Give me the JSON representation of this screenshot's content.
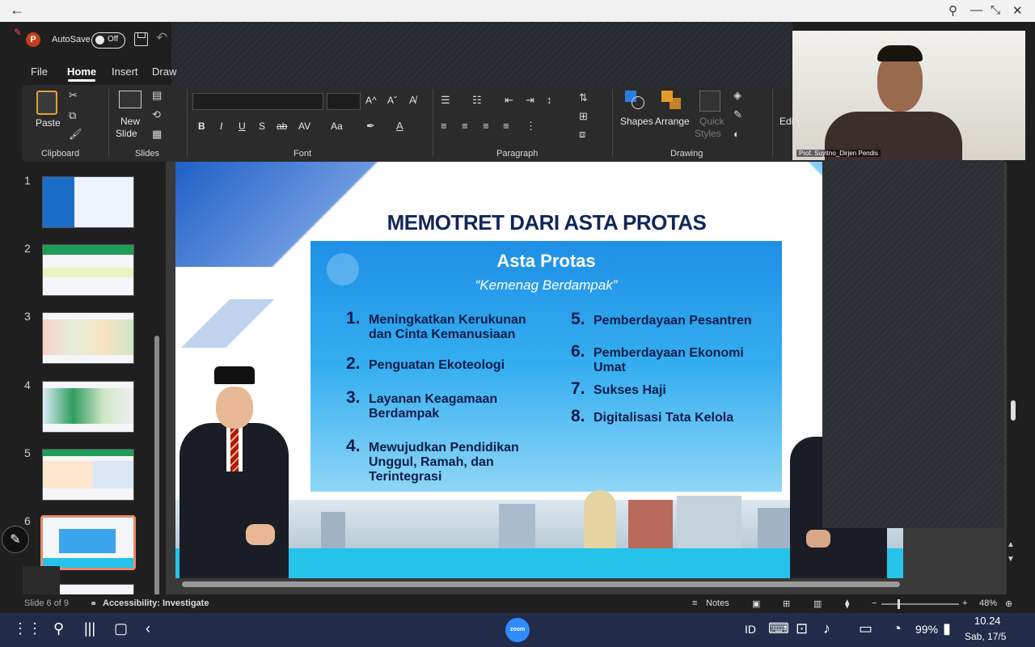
{
  "window": {
    "pin_icon": "pin-icon",
    "minimize_label": "—",
    "restore_label": "⤡",
    "close_label": "✕"
  },
  "titlebar": {
    "autosave_label": "AutoSave",
    "autosave_state": "Off",
    "app_logo": "P"
  },
  "tabs": [
    "File",
    "Home",
    "Insert",
    "Draw"
  ],
  "ribbon": {
    "clipboard": {
      "paste": "Paste",
      "label": "Clipboard"
    },
    "slides": {
      "new_slide": "New",
      "new_slide2": "Slide",
      "label": "Slides"
    },
    "font": {
      "label": "Font",
      "bold": "B",
      "italic": "I",
      "underline": "U",
      "strike_s": "S",
      "strike": "ab",
      "spacing": "AV",
      "case": "Aa",
      "grow": "A^",
      "shrink": "Aˇ"
    },
    "paragraph": {
      "label": "Paragraph"
    },
    "drawing": {
      "shapes": "Shapes",
      "arrange": "Arrange",
      "quick_styles_1": "Quick",
      "quick_styles_2": "Styles",
      "label": "Drawing"
    },
    "editing": {
      "label": "Edi"
    }
  },
  "thumbnails": [
    {
      "num": "1"
    },
    {
      "num": "2"
    },
    {
      "num": "3"
    },
    {
      "num": "4"
    },
    {
      "num": "5"
    },
    {
      "num": "6",
      "selected": true
    }
  ],
  "slide": {
    "title": "MEMOTRET DARI ASTA PROTAS",
    "panel_title": "Asta Protas",
    "panel_subtitle": "“Kemenag Berdampak”",
    "items_left": [
      {
        "n": "1.",
        "text": "Meningkatkan Kerukunan dan Cinta Kemanusiaan"
      },
      {
        "n": "2.",
        "text": "Penguatan Ekoteologi"
      },
      {
        "n": "3.",
        "text": "Layanan Keagamaan Berdampak"
      },
      {
        "n": "4.",
        "text": "Mewujudkan Pendidikan Unggul, Ramah, dan Terintegrasi"
      }
    ],
    "items_right": [
      {
        "n": "5.",
        "text": "Pemberdayaan Pesantren"
      },
      {
        "n": "6.",
        "text": "Pemberdayaan Ekonomi Umat"
      },
      {
        "n": "7.",
        "text": "Sukses Haji"
      },
      {
        "n": "8.",
        "text": "Digitalisasi Tata Kelola"
      }
    ]
  },
  "webcam": {
    "name_label": "Prof. Suyitno_Dirjen Pendis"
  },
  "status": {
    "slide_counter": "Slide 6 of 9",
    "accessibility": "Accessibility: Investigate",
    "notes": "Notes",
    "zoom": "48%"
  },
  "navbar": {
    "zoom_app": "zoom",
    "lang": "ID",
    "battery": "99%",
    "time": "10.24",
    "date": "Sab, 17/5"
  },
  "colors": {
    "accent": "#c43e1c",
    "slide_title": "#13265a",
    "panel_blue": "#1e8fe6",
    "nav_bg": "#202c4a"
  }
}
